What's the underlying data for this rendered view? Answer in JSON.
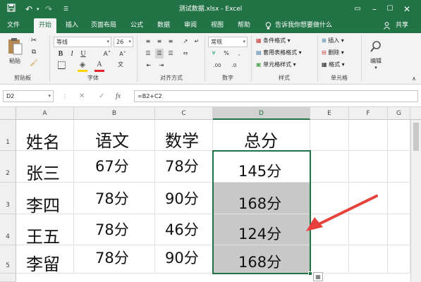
{
  "titlebar": {
    "title": "测试数据.xlsx - Excel",
    "save_icon": "save-icon",
    "undo_icon": "undo-icon",
    "redo_icon": "redo-icon",
    "customize_icon": "customize-quick-access-icon",
    "ribbon_display_icon": "ribbon-display-options-icon",
    "accent": "#217346"
  },
  "menu": {
    "tabs": [
      "文件",
      "开始",
      "插入",
      "页面布局",
      "公式",
      "数据",
      "审阅",
      "视图",
      "帮助"
    ],
    "active_tab": "开始",
    "tell_me": "告诉我你想要做什么",
    "share": "共享"
  },
  "ribbon": {
    "clipboard": {
      "paste": "粘贴",
      "label": "剪贴板"
    },
    "font": {
      "name": "等线",
      "size": "26",
      "label": "字体"
    },
    "alignment": {
      "label": "对齐方式"
    },
    "number": {
      "format": "常规",
      "label": "数字"
    },
    "styles": {
      "conditional": "条件格式",
      "table": "套用表格格式",
      "cell": "单元格样式",
      "label": "样式"
    },
    "cells": {
      "insert": "插入",
      "delete": "删除",
      "format": "格式",
      "label": "单元格"
    },
    "editing": {
      "label": "编辑"
    }
  },
  "formula_bar": {
    "name_box": "D2",
    "formula": "=B2+C2",
    "fx": "fx"
  },
  "sheet": {
    "columns": [
      "A",
      "B",
      "C",
      "D",
      "E",
      "F",
      "G"
    ],
    "rows": [
      "1",
      "2",
      "3",
      "4",
      "5"
    ],
    "selected_column": "D",
    "headers": [
      "姓名",
      "语文",
      "数学",
      "总分"
    ],
    "data": [
      [
        "张三",
        "67分",
        "78分",
        "145分"
      ],
      [
        "李四",
        "78分",
        "90分",
        "168分"
      ],
      [
        "王五",
        "78分",
        "46分",
        "124分"
      ],
      [
        "李留",
        "78分",
        "90分",
        "168分"
      ]
    ],
    "selection_color": "#217346",
    "arrow_color": "#e8413b"
  }
}
